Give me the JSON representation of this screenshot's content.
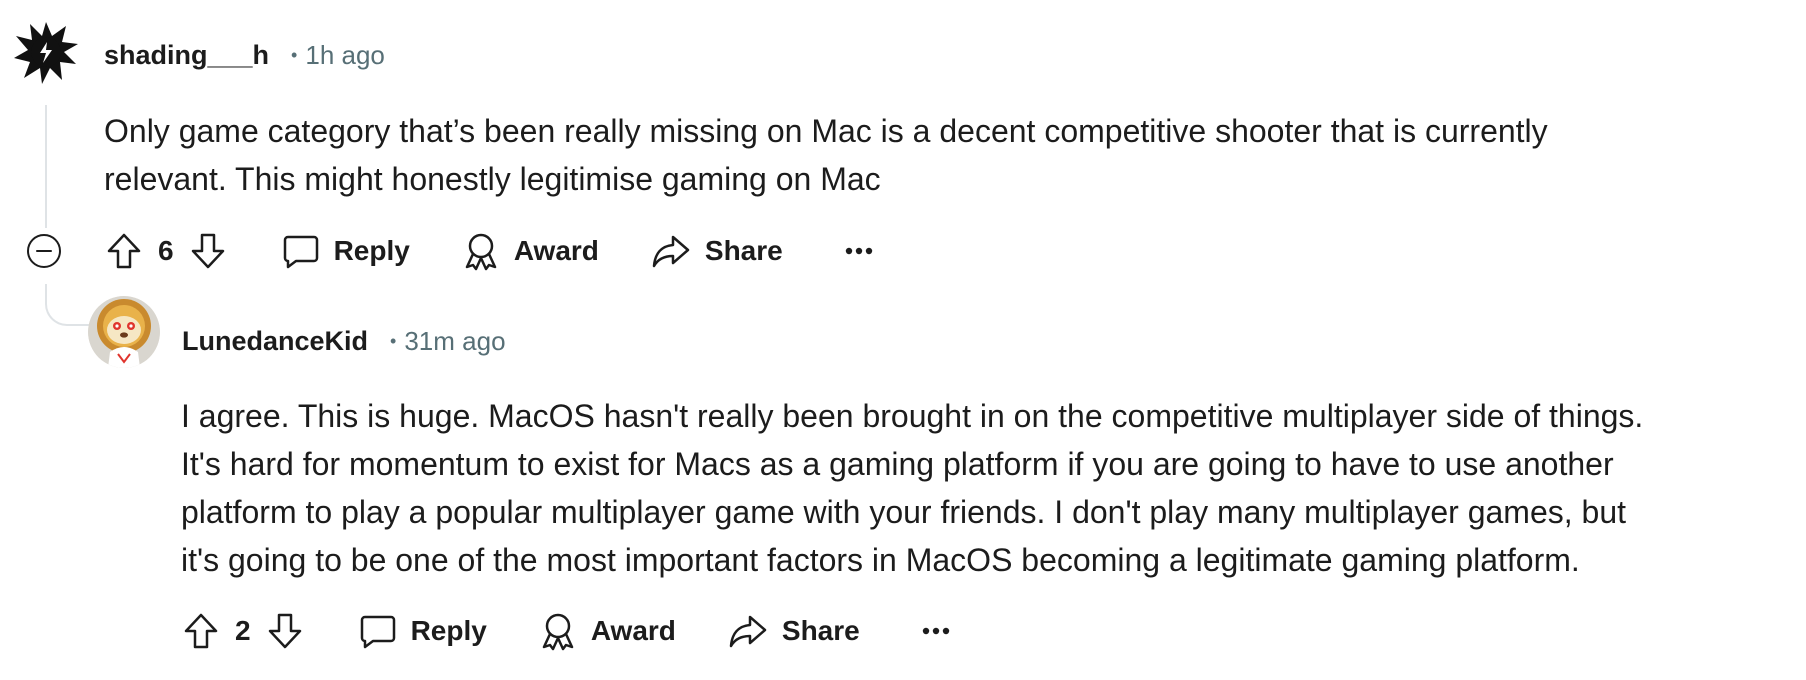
{
  "comments": [
    {
      "username": "shading___h",
      "separator": "•",
      "time": "1h ago",
      "body_lines": [
        "Only game category that’s been really missing on Mac is a decent competitive shooter that is currently",
        "relevant. This might honestly legitimise gaming on Mac"
      ],
      "score": "6",
      "avatar_icon": "black-splash-avatar-icon"
    },
    {
      "username": "LunedanceKid",
      "separator": "•",
      "time": "31m ago",
      "body_lines": [
        "I agree. This is huge. MacOS hasn't really been brought in on the competitive multiplayer side of things.",
        "It's hard for momentum to exist for Macs as a gaming platform if you are going to have to use another",
        "platform to play a popular multiplayer game with your friends. I don't play many multiplayer games, but",
        "it's going to be one of the most important factors in MacOS becoming a legitimate gaming platform."
      ],
      "score": "2",
      "avatar_icon": "lion-snoo-avatar-icon"
    }
  ],
  "actions": {
    "reply": "Reply",
    "award": "Award",
    "share": "Share",
    "more": "•••"
  },
  "icons": {
    "collapse": "collapse-minus-icon",
    "upvote": "upvote-arrow-icon",
    "downvote": "downvote-arrow-icon",
    "reply": "speech-bubble-icon",
    "award": "award-ribbon-icon",
    "share": "share-arrow-icon",
    "more": "ellipsis-icon"
  },
  "colors": {
    "text": "#1c1c1c",
    "meta": "#576f76",
    "thread_line": "#dfe3e6"
  }
}
